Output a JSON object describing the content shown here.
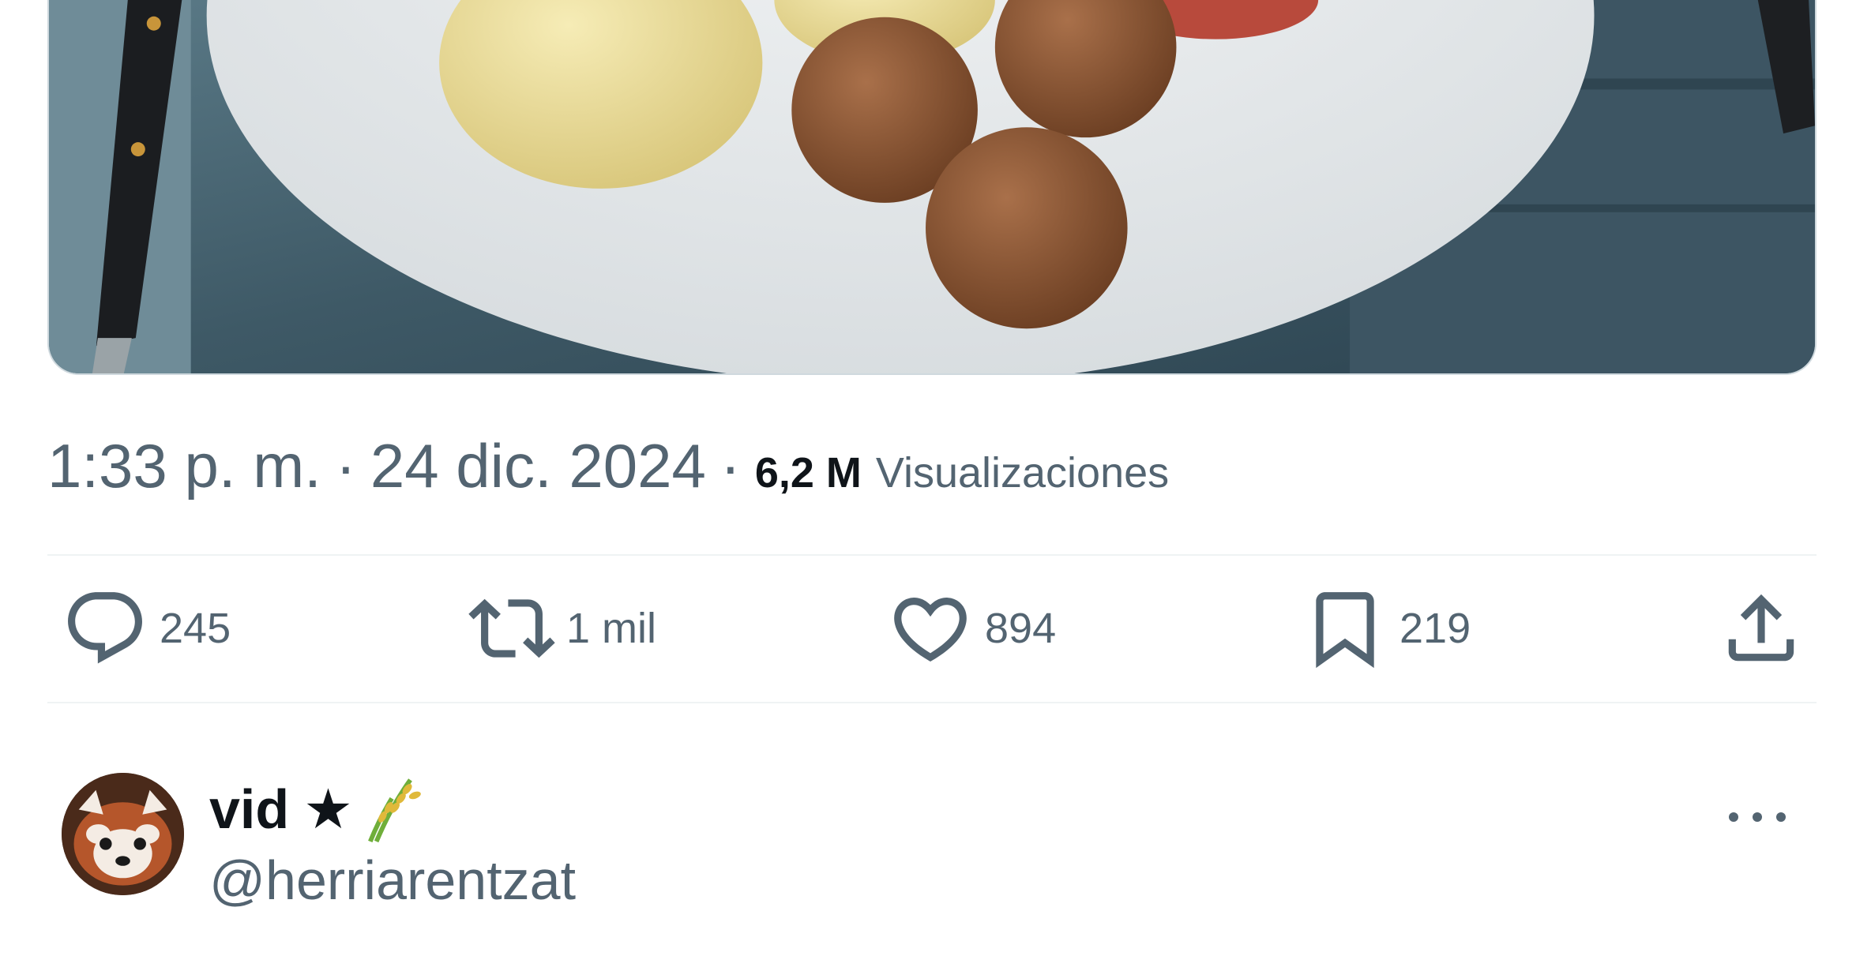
{
  "tweet": {
    "time": "1:33 p. m.",
    "separator": "·",
    "date": "24 dic. 2024",
    "views_count": "6,2 M",
    "views_label": "Visualizaciones",
    "media_icon": "food-photo"
  },
  "actions": {
    "reply": {
      "icon": "reply-icon",
      "count": "245"
    },
    "retweet": {
      "icon": "retweet-icon",
      "count": "1 mil"
    },
    "like": {
      "icon": "heart-icon",
      "count": "894"
    },
    "bookmark": {
      "icon": "bookmark-icon",
      "count": "219"
    },
    "share": {
      "icon": "share-icon"
    }
  },
  "reply_author": {
    "name": "vid",
    "star": "★",
    "emoji": "rice-plant",
    "handle": "@herriarentzat"
  },
  "colors": {
    "text_primary": "#0f1419",
    "text_secondary": "#536471",
    "divider": "#eff3f4"
  }
}
